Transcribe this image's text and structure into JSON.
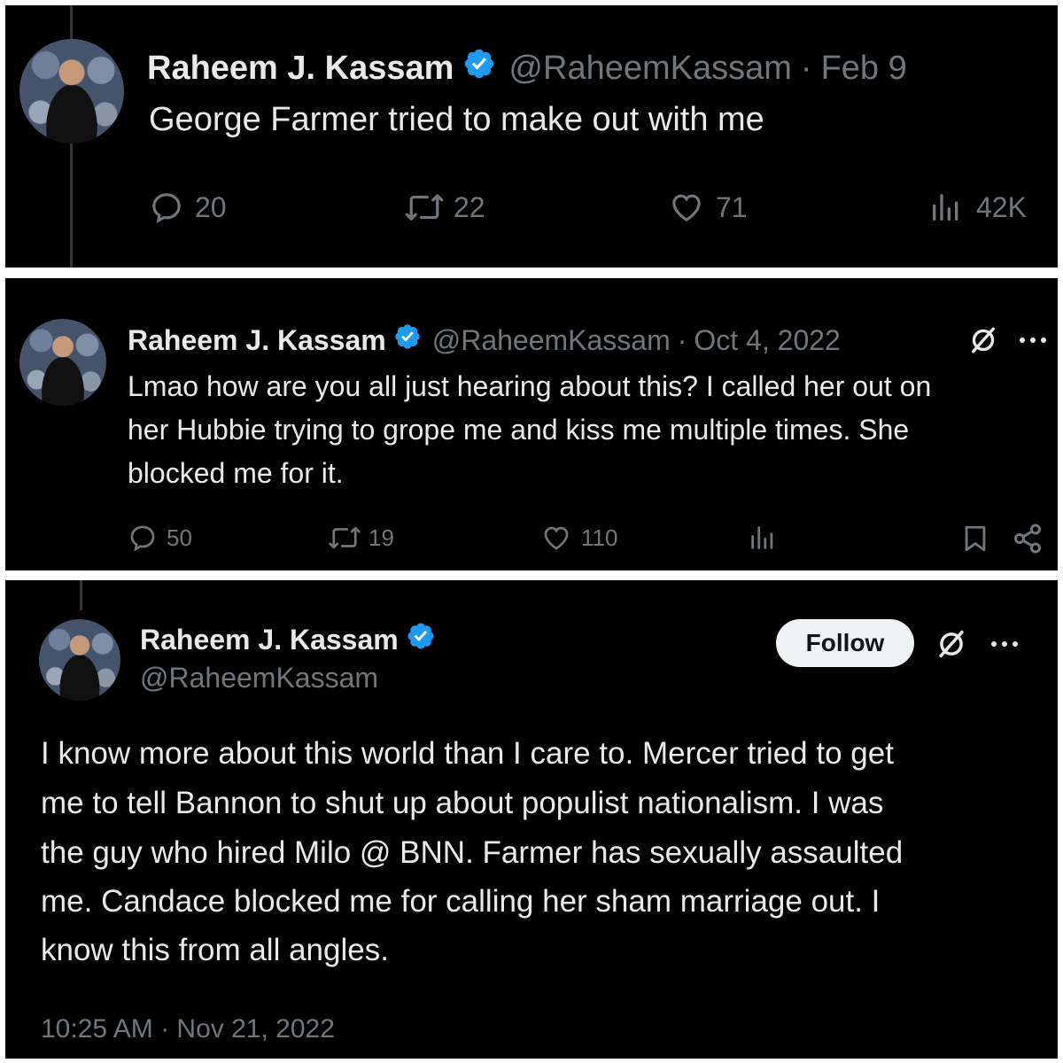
{
  "tweet1": {
    "name": "Raheem J. Kassam",
    "handle": "@RaheemKassam",
    "date": "Feb 9",
    "text": "George Farmer tried to make out with me",
    "replies": "20",
    "retweets": "22",
    "likes": "71",
    "views": "42K"
  },
  "tweet2": {
    "name": "Raheem J. Kassam",
    "handle": "@RaheemKassam",
    "date": "Oct 4, 2022",
    "text_lines": [
      "Lmao how are you all just hearing about this? I called her out on",
      "her Hubbie trying to grope me and kiss me multiple times. She",
      "blocked me for it."
    ],
    "replies": "50",
    "retweets": "19",
    "likes": "110"
  },
  "tweet3": {
    "name": "Raheem J. Kassam",
    "handle": "@RaheemKassam",
    "follow_label": "Follow",
    "text_lines": [
      "I know more about this world than I care to. Mercer tried to get",
      "me to tell Bannon to shut up about populist nationalism. I was",
      "the guy who hired Milo @ BNN. Farmer has sexually assaulted",
      "me. Candace blocked me for calling her sham marriage out. I",
      "know this from all angles."
    ],
    "timestamp": "10:25 AM · Nov 21, 2022"
  },
  "colors": {
    "background": "#000000",
    "text": "#e7e9ea",
    "muted": "#71767b",
    "verified": "#1d9bf0"
  }
}
